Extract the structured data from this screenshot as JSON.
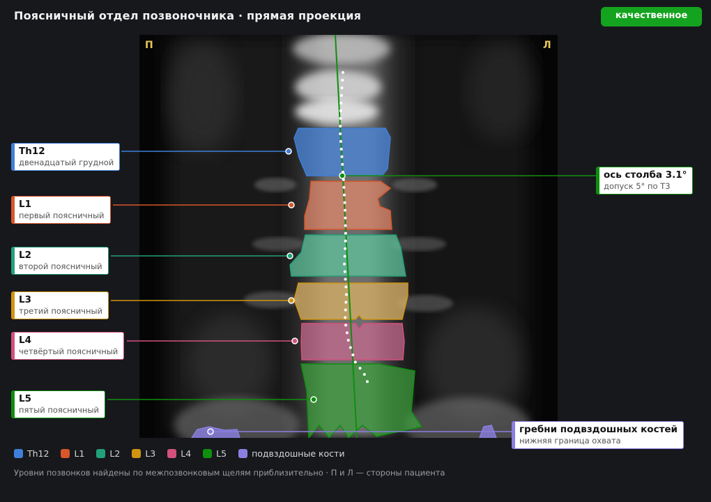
{
  "header": {
    "title": "Поясничный отдел позвоночника · прямая проекция",
    "quality_badge": "качественное"
  },
  "scan": {
    "left_marker": "П",
    "right_marker": "Л"
  },
  "vertebrae": [
    {
      "id": "th12",
      "label": "Th12",
      "description": "двенадцатый грудной",
      "color": "#3f7fd9"
    },
    {
      "id": "l1",
      "label": "L1",
      "description": "первый поясничный",
      "color": "#d8562b"
    },
    {
      "id": "l2",
      "label": "L2",
      "description": "второй поясничный",
      "color": "#22a07a"
    },
    {
      "id": "l3",
      "label": "L3",
      "description": "третий поясничный",
      "color": "#d19410"
    },
    {
      "id": "l4",
      "label": "L4",
      "description": "четвёртый поясничный",
      "color": "#d4517e"
    },
    {
      "id": "l5",
      "label": "L5",
      "description": "пятый поясничный",
      "color": "#0e8f0e"
    }
  ],
  "axis": {
    "title": "ось столба 3.1°",
    "subtitle": "допуск 5° по Т3",
    "color": "#0e8f0e"
  },
  "iliac": {
    "title": "гребни подвздошных костей",
    "subtitle": "нижняя граница охвата",
    "color": "#8a7fe0"
  },
  "legend": [
    {
      "label": "Th12",
      "color": "#3f7fd9"
    },
    {
      "label": "L1",
      "color": "#d8562b"
    },
    {
      "label": "L2",
      "color": "#22a07a"
    },
    {
      "label": "L3",
      "color": "#d19410"
    },
    {
      "label": "L4",
      "color": "#d4517e"
    },
    {
      "label": "L5",
      "color": "#0e8f0e"
    },
    {
      "label": "подвздошные кости",
      "color": "#8a7fe0"
    }
  ],
  "footnote": "Уровни позвонков найдены по межпозвонковым щелям приблизительно · П и Л — стороны пациента"
}
